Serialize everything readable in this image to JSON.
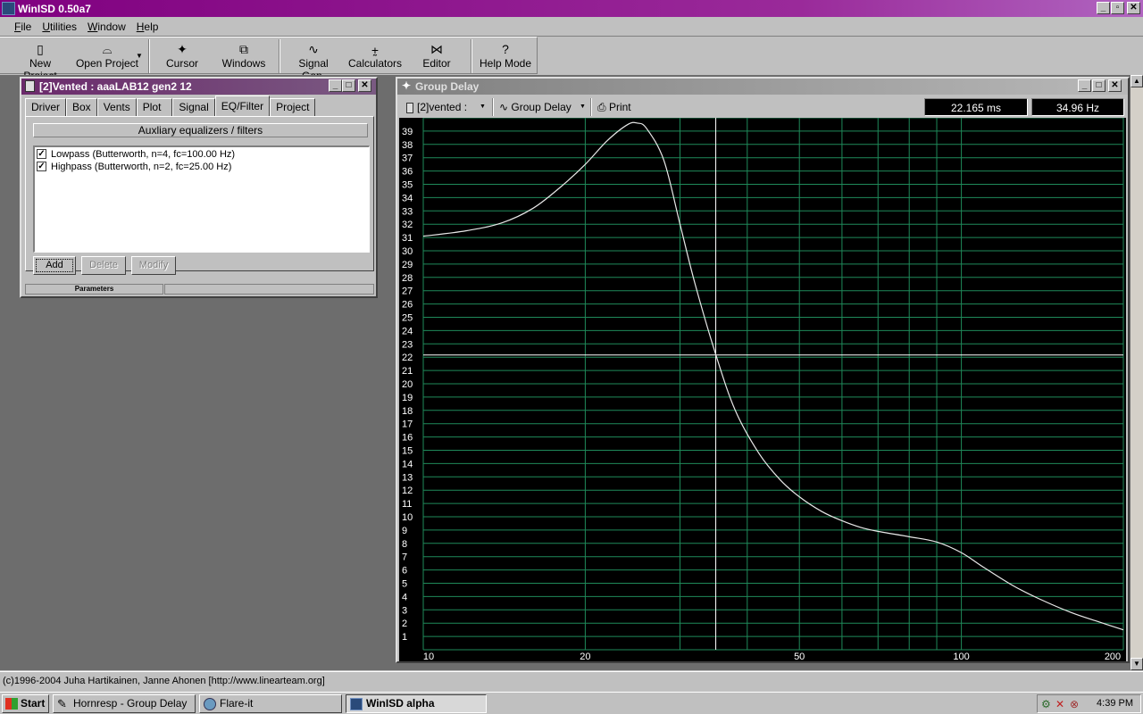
{
  "app": {
    "title": "WinISD 0.50a7",
    "window_controls": [
      "_",
      "▫",
      "✕"
    ]
  },
  "menu": [
    {
      "label": "File",
      "underline": "F",
      "rest": "ile"
    },
    {
      "label": "Utilities",
      "underline": "U",
      "rest": "tilities"
    },
    {
      "label": "Window",
      "underline": "W",
      "rest": "indow"
    },
    {
      "label": "Help",
      "underline": "H",
      "rest": "elp"
    }
  ],
  "toolbar": {
    "new_project": "New Project",
    "open_project": "Open Project",
    "cursor": "Cursor",
    "windows": "Windows",
    "signal_gen": "Signal Gen.",
    "calculators": "Calculators",
    "editor": "Editor",
    "help_mode": "Help Mode"
  },
  "vented_window": {
    "title": "[2]Vented : aaaLAB12 gen2 12",
    "tabs": [
      "Driver",
      "Box",
      "Vents",
      "Plot",
      "Signal",
      "EQ/Filter",
      "Project"
    ],
    "active_tab": "EQ/Filter",
    "aux_header": "Auxliary equalizers / filters",
    "filters": [
      {
        "label": "Lowpass (Butterworth, n=4, fc=100.00 Hz)",
        "checked": true
      },
      {
        "label": "Highpass (Butterworth, n=2, fc=25.00 Hz)",
        "checked": true
      }
    ],
    "buttons": {
      "add": "Add",
      "delete": "Delete",
      "modify": "Modify"
    },
    "params_label": "Parameters"
  },
  "group_delay_window": {
    "title": "Group Delay",
    "project_select": "[2]vented :",
    "graph_select": "Group Delay",
    "print": "Print",
    "readout_time": "22.165 ms",
    "readout_freq": "34.96 Hz"
  },
  "chart_data": {
    "type": "line",
    "x_scale": "log",
    "xlim": [
      10,
      200
    ],
    "ylim": [
      0,
      40
    ],
    "x_tick_labels": [
      "10",
      "20",
      "50",
      "100",
      "200"
    ],
    "x_tick_values": [
      10,
      20,
      50,
      100,
      200
    ],
    "y_tick_values": [
      1,
      2,
      3,
      4,
      5,
      6,
      7,
      8,
      9,
      10,
      11,
      12,
      13,
      14,
      15,
      16,
      17,
      18,
      19,
      20,
      21,
      22,
      23,
      24,
      25,
      26,
      27,
      28,
      29,
      30,
      31,
      32,
      33,
      34,
      35,
      36,
      37,
      38,
      39
    ],
    "grid": true,
    "cursor": {
      "x": 34.96,
      "y": 22.165
    },
    "series": [
      {
        "x": [
          10,
          12,
          14,
          16,
          18,
          20,
          22,
          24,
          25,
          26,
          28,
          30,
          32,
          34.96,
          38,
          42,
          46,
          50,
          55,
          60,
          65,
          70,
          80,
          90,
          100,
          110,
          125,
          140,
          160,
          180,
          200
        ],
        "y": [
          31.1,
          31.5,
          32.1,
          33.2,
          34.8,
          36.5,
          38.3,
          39.5,
          39.6,
          39.2,
          36.8,
          32.0,
          27.5,
          22.2,
          18.0,
          14.8,
          12.8,
          11.5,
          10.4,
          9.7,
          9.2,
          8.9,
          8.5,
          8.1,
          7.3,
          6.2,
          4.8,
          3.8,
          2.8,
          2.1,
          1.5
        ]
      }
    ]
  },
  "statusbar": {
    "text": "(c)1996-2004 Juha Hartikainen, Janne Ahonen [http://www.linearteam.org]"
  },
  "taskbar": {
    "start": "Start",
    "tasks": [
      "Hornresp - Group Delay",
      "Flare-it",
      "WinISD alpha"
    ],
    "active_task": "WinISD alpha",
    "clock": "4:39 PM"
  }
}
